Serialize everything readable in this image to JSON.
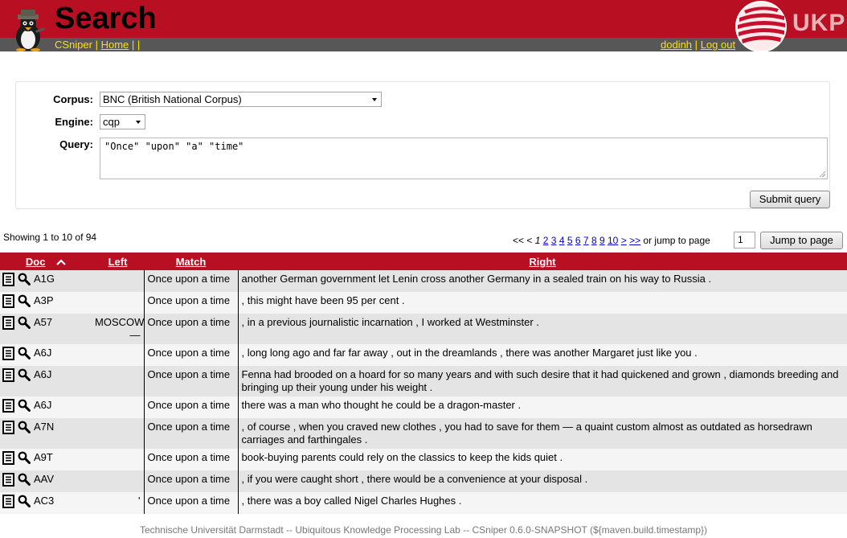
{
  "header": {
    "title": "Search",
    "nav_left": {
      "app_name": "CSniper",
      "sep1": "|",
      "home": "Home",
      "sep2": "| |"
    },
    "nav_right": {
      "user": "dodinh",
      "sep": "|",
      "logout": "Log out"
    },
    "logo_text": "UKP",
    "colors": {
      "brand_red": "#b80f22",
      "nav_grey": "#575757",
      "link_yellow": "#ffe000"
    }
  },
  "form": {
    "corpus_label": "Corpus:",
    "corpus_value": "BNC (British National Corpus)",
    "engine_label": "Engine:",
    "engine_value": "cqp",
    "query_label": "Query:",
    "query_value": "\"Once\" \"upon\" \"a\" \"time\"",
    "submit_label": "Submit query"
  },
  "results": {
    "showing_text": "Showing 1 to 10 of 94",
    "pager": {
      "first": "<<",
      "prev": "<",
      "current": "1",
      "pages": [
        "2",
        "3",
        "4",
        "5",
        "6",
        "7",
        "8",
        "9",
        "10"
      ],
      "next": ">",
      "last": ">>",
      "jump_text": "or jump to page",
      "jump_value": "1",
      "jump_button": "Jump to page"
    },
    "columns": {
      "doc": "Doc",
      "left": "Left",
      "match": "Match",
      "right": "Right"
    },
    "rows": [
      {
        "doc": "A1G",
        "left": "",
        "match": "Once upon a time",
        "right": "another German government let Lenin cross another Germany in a sealed train on his way to Russia ."
      },
      {
        "doc": "A3P",
        "left": "",
        "match": "Once upon a time",
        "right": ", this might have been 95 per cent ."
      },
      {
        "doc": "A57",
        "left": "MOSCOW —",
        "match": "Once upon a time",
        "right": ", in a previous journalistic incarnation , I worked at Westminster ."
      },
      {
        "doc": "A6J",
        "left": "",
        "match": "Once upon a time",
        "right": ", long long ago and far far away , out in the dreamlands , there was another Margaret just like you ."
      },
      {
        "doc": "A6J",
        "left": "",
        "match": "Once upon a time",
        "right": "Fenna had brooded on a hoard for so many years and with such desire that it had quickened and grown , diamonds breeding and bringing up their young under his weight ."
      },
      {
        "doc": "A6J",
        "left": "",
        "match": "Once upon a time",
        "right": "there was a man who thought he could be a dragon-master ."
      },
      {
        "doc": "A7N",
        "left": "",
        "match": "Once upon a time",
        "right": ", of course , when you craved new clothes , you had to save for them — a quaint custom almost as outdated as horsedrawn carriages and farthingales ."
      },
      {
        "doc": "A9T",
        "left": "",
        "match": "Once upon a time",
        "right": "book-buying parents could rely on the classics to keep the kids quiet ."
      },
      {
        "doc": "AAV",
        "left": "",
        "match": "Once upon a time",
        "right": ", if you were caught short , there would be a convenience at your disposal ."
      },
      {
        "doc": "AC3",
        "left": "'",
        "match": "Once upon a time",
        "right": ", there was a boy called Nigel Charles Hughes ."
      }
    ]
  },
  "footer": {
    "text": "Technische Universität Darmstadt -- Ubiquitous Knowledge Processing Lab -- CSniper 0.6.0-SNAPSHOT (${maven.build.timestamp})"
  },
  "icons": [
    "penguin-logo-icon",
    "ukp-logo-icon",
    "document-icon",
    "magnifier-icon",
    "sort-ascending-icon",
    "dropdown-arrow-icon"
  ]
}
